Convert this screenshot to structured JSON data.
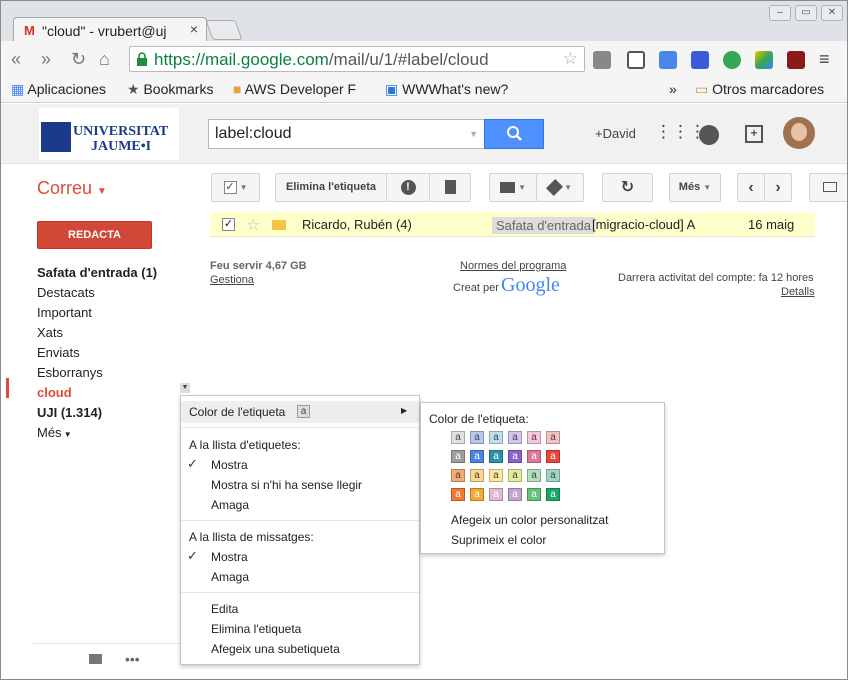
{
  "browser": {
    "tab_title": "\"cloud\" - vrubert@uj",
    "tab_close": "×",
    "url_host": "https://mail.google.com",
    "url_path": "/mail/u/1/#label/cloud",
    "bookmarks": [
      "Aplicaciones",
      "Bookmarks",
      "AWS Developer F",
      "WWWhat's new?"
    ],
    "bookmarks_overflow": "»",
    "other_bookmarks": "Otros marcadores"
  },
  "header": {
    "logo_line1": "UNIVERSITAT",
    "logo_line2": "JAUME•I",
    "search_value": "label:cloud",
    "user_name": "+David"
  },
  "toolbar": {
    "app_name": "Correu",
    "remove_label_button": "Elimina l'etiqueta",
    "more_button": "Més"
  },
  "sidebar": {
    "compose": "REDACTA",
    "items": [
      {
        "label": "Safata d'entrada (1)",
        "bold": true
      },
      {
        "label": "Destacats"
      },
      {
        "label": "Important"
      },
      {
        "label": "Xats"
      },
      {
        "label": "Enviats"
      },
      {
        "label": "Esborranys"
      },
      {
        "label": "cloud",
        "current": true
      },
      {
        "label": "UJI (1.314)",
        "bold": true
      },
      {
        "label": "Més"
      }
    ]
  },
  "messages": [
    {
      "sender": "Ricardo, Rubén (4)",
      "label": "Safata d'entrada",
      "subject": "[migracio-cloud] A",
      "date": "16 maig",
      "selected": true,
      "starred": false
    }
  ],
  "footer": {
    "storage": "Feu servir 4,67 GB",
    "manage": "Gestiona",
    "policies": "Normes del programa",
    "powered_by": "Creat per",
    "google": "Google",
    "activity": "Darrera activitat del compte: fa 12 hores",
    "details": "Detalls"
  },
  "context_menu": {
    "label_color": "Color de l'etiqueta",
    "label_color_badge": "a",
    "label_list_header": "A la llista d'etiquetes:",
    "label_list_items": [
      "Mostra",
      "Mostra si n'hi ha sense llegir",
      "Amaga"
    ],
    "message_list_header": "A la llista de missatges:",
    "message_list_items": [
      "Mostra",
      "Amaga"
    ],
    "actions": [
      "Edita",
      "Elimina l'etiqueta",
      "Afegeix una subetiqueta"
    ]
  },
  "color_submenu": {
    "title": "Color de l'etiqueta:",
    "swatch_letter": "a",
    "swatches": [
      [
        "#e0e0e0",
        "#b5c9f0",
        "#bde0ec",
        "#d6c3ee",
        "#f6c6e0",
        "#f4c2bd"
      ],
      [
        "#9e9e9e",
        "#4a86e8",
        "#2a93a8",
        "#8e63ce",
        "#e07798",
        "#e8453c"
      ],
      [
        "#f6a875",
        "#fdd58b",
        "#ffe89c",
        "#e6eb9a",
        "#b3e0b9",
        "#9fd6c2"
      ],
      [
        "#f07a2e",
        "#f6a833",
        "#e5b8d4",
        "#c3a4cf",
        "#65c27c",
        "#16a765"
      ]
    ],
    "add_custom": "Afegeix un color personalitzat",
    "remove_color": "Suprimeix el color"
  }
}
